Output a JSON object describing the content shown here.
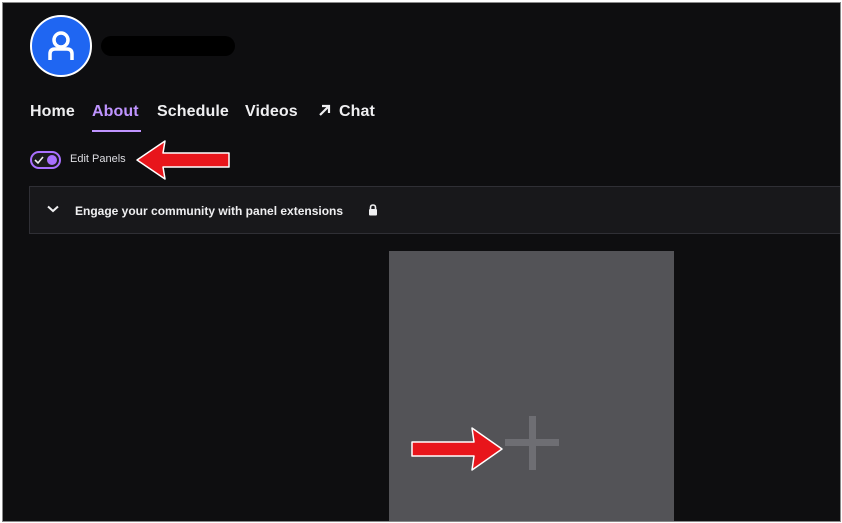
{
  "header": {
    "avatar_icon": "user-icon",
    "channel_name_redacted": true
  },
  "tabs": [
    {
      "label": "Home",
      "active": false
    },
    {
      "label": "About",
      "active": true
    },
    {
      "label": "Schedule",
      "active": false
    },
    {
      "label": "Videos",
      "active": false
    },
    {
      "label": "Chat",
      "active": false,
      "icon": "external-arrow-icon"
    }
  ],
  "edit_panels": {
    "label": "Edit Panels",
    "enabled": true
  },
  "extensions_banner": {
    "text": "Engage your community with panel extensions",
    "icons": [
      "chevron-down-icon",
      "lock-icon"
    ]
  },
  "add_panel": {
    "icon": "plus-icon"
  },
  "annotations": {
    "arrow_color": "#e8151b",
    "arrows": [
      "arrow-to-edit-panels",
      "arrow-to-add-panel"
    ]
  },
  "colors": {
    "background": "#0e0e10",
    "accent": "#bf94ff",
    "avatar": "#1f66f2",
    "panel": "#535357"
  }
}
